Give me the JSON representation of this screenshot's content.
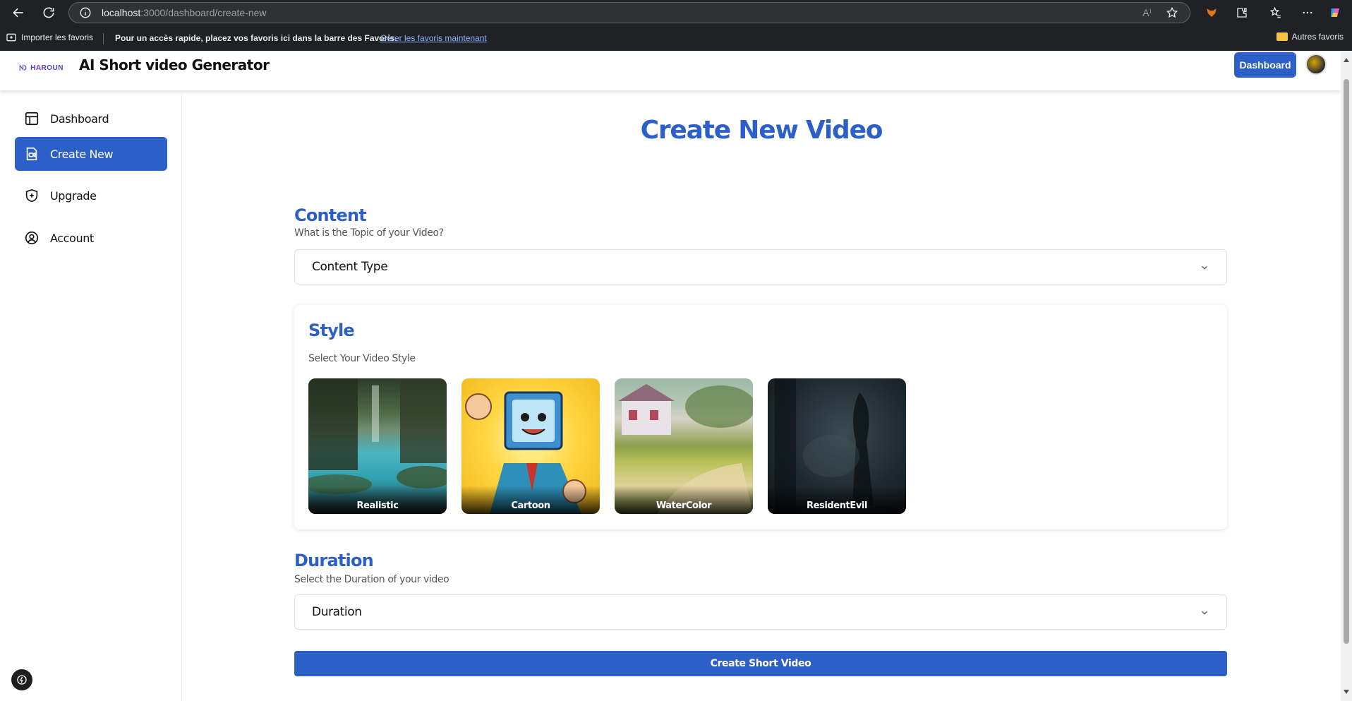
{
  "browser": {
    "url_host": "localhost",
    "url_path": ":3000/dashboard/create-new",
    "read_aloud": "A⁾",
    "bookmarks": {
      "import_label": "Importer les favoris",
      "message": "Pour un accès rapide, placez vos favoris ici dans la barre des Favoris.",
      "link": "Gérer les favoris maintenant",
      "other": "Autres favoris"
    }
  },
  "header": {
    "logo_text": "HAROUN",
    "title": "AI Short video Generator",
    "dashboard_button": "Dashboard"
  },
  "sidebar": {
    "items": [
      {
        "label": "Dashboard",
        "icon": "layout-icon"
      },
      {
        "label": "Create New",
        "icon": "file-video-icon",
        "active": true
      },
      {
        "label": "Upgrade",
        "icon": "shield-plus-icon"
      },
      {
        "label": "Account",
        "icon": "user-circle-icon"
      }
    ]
  },
  "main": {
    "title": "Create New Video",
    "content": {
      "heading": "Content",
      "subtitle": "What is the Topic of your Video?",
      "placeholder": "Content Type"
    },
    "style": {
      "heading": "Style",
      "subtitle": "Select Your Video Style",
      "options": [
        {
          "label": "Realistic"
        },
        {
          "label": "Cartoon"
        },
        {
          "label": "WaterColor"
        },
        {
          "label": "ResidentEvil"
        }
      ]
    },
    "duration": {
      "heading": "Duration",
      "subtitle": "Select the Duration of your video",
      "placeholder": "Duration"
    },
    "create_button": "Create Short Video"
  },
  "colors": {
    "accent": "#2c5fc8",
    "chrome_bg": "#202124"
  }
}
